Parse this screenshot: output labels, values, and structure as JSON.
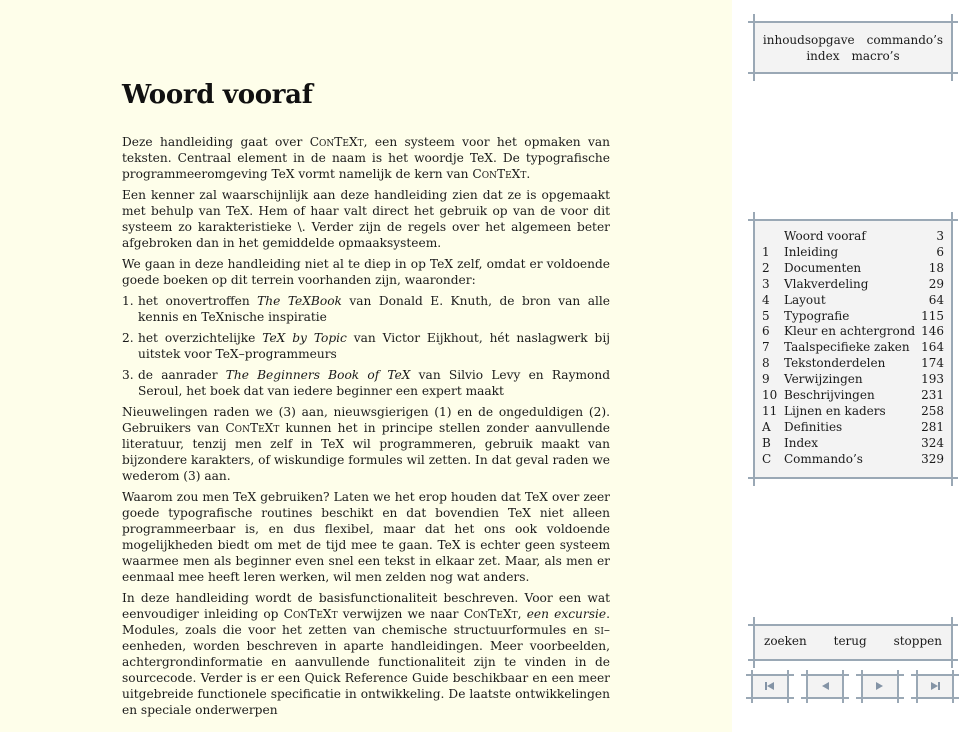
{
  "page": {
    "title": "Woord vooraf",
    "paragraphs": {
      "p1": {
        "a": "Deze handleiding gaat over ",
        "context": "ConTeXt",
        "b": ", een systeem voor het opmaken van teksten. Centraal element in de naam is het woordje TeX. De typografische programmeeromgeving TeX vormt namelijk de kern van ",
        "context2": "ConTeXt",
        "c": "."
      },
      "p2": "Een kenner zal waarschijnlijk aan deze handleiding zien dat ze is opgemaakt met behulp van TeX. Hem of haar valt direct het gebruik op van de voor dit systeem zo karakteristieke \\. Verder zijn de regels over het algemeen beter afgebroken dan in het gemiddelde opmaaksysteem.",
      "p3": "We gaan in deze handleiding niet al te diep in op TeX zelf, omdat er voldoende goede boeken op dit terrein voorhanden zijn, waaronder:",
      "list": [
        {
          "num": "1.",
          "a": "het onovertroffen ",
          "title": "The TeXBook",
          "b": " van Donald E. Knuth, de bron van alle kennis en TeXnische inspiratie"
        },
        {
          "num": "2.",
          "a": "het overzichtelijke ",
          "title": "TeX by Topic",
          "b": " van Victor Eijkhout, hét naslagwerk bij uitstek voor TeX–programmeurs"
        },
        {
          "num": "3.",
          "a": "de aanrader ",
          "title": "The Beginners Book of TeX",
          "b": " van Silvio Levy en Raymond Seroul, het boek dat van iedere beginner een expert maakt"
        }
      ],
      "p4": {
        "a": "Nieuwelingen raden we (3) aan, nieuwsgierigen (1) en de ongeduldigen (2). Gebruikers van ",
        "context": "ConTeXt",
        "b": " kunnen het in principe stellen zonder aanvullende literatuur, tenzij men zelf in TeX wil programmeren, gebruik maakt van bijzondere karakters, of wiskundige formules wil zetten. In dat geval raden we wederom (3) aan."
      },
      "p5": "Waarom zou men TeX gebruiken? Laten we het erop houden dat TeX over zeer goede typografische routines beschikt en dat bovendien TeX niet alleen programmeerbaar is, en dus flexibel, maar dat het ons ook voldoende mogelijkheden biedt om met de tijd mee te gaan. TeX is echter geen systeem waarmee men als beginner even snel een tekst in elkaar zet. Maar, als men er eenmaal mee heeft leren werken, wil men zelden nog wat anders.",
      "p6": {
        "a": "In deze handleiding wordt de basisfunctionaliteit beschreven. Voor een wat eenvoudiger inleiding op ",
        "context": "ConTeXt",
        "b": " verwijzen we naar ",
        "context2": "ConTeXt",
        "c": ", ",
        "em": "een excursie",
        "d": ". Modules, zoals die voor het zetten van chemische structuurformules en ",
        "si": "si",
        "e": "–eenheden, worden beschreven in aparte handleidingen. Meer voorbeelden, achtergrondinformatie en aanvullende functionaliteit zijn te vinden in de sourcecode. Verder is er een Quick Reference Guide beschikbaar en een meer uitgebreide functionele specificatie in ontwikkeling. De laatste ontwikkelingen en speciale onderwerpen"
      }
    }
  },
  "sidebar": {
    "top_links": [
      "inhoudsopgave",
      "commando’s",
      "index",
      "macro’s"
    ],
    "toc": [
      {
        "num": "",
        "label": "Woord vooraf",
        "page": "3"
      },
      {
        "num": "1",
        "label": "Inleiding",
        "page": "6"
      },
      {
        "num": "2",
        "label": "Documenten",
        "page": "18"
      },
      {
        "num": "3",
        "label": "Vlakverdeling",
        "page": "29"
      },
      {
        "num": "4",
        "label": "Layout",
        "page": "64"
      },
      {
        "num": "5",
        "label": "Typografie",
        "page": "115"
      },
      {
        "num": "6",
        "label": "Kleur en achtergrond",
        "page": "146"
      },
      {
        "num": "7",
        "label": "Taalspecifieke zaken",
        "page": "164"
      },
      {
        "num": "8",
        "label": "Tekstonderdelen",
        "page": "174"
      },
      {
        "num": "9",
        "label": "Verwijzingen",
        "page": "193"
      },
      {
        "num": "10",
        "label": "Beschrijvingen",
        "page": "231"
      },
      {
        "num": "11",
        "label": "Lijnen en kaders",
        "page": "258"
      },
      {
        "num": "A",
        "label": "Definities",
        "page": "281"
      },
      {
        "num": "B",
        "label": "Index",
        "page": "324"
      },
      {
        "num": "C",
        "label": "Commando’s",
        "page": "329"
      }
    ],
    "bottom_links": [
      "zoeken",
      "terug",
      "stoppen"
    ],
    "nav_icons": [
      "first-page-icon",
      "previous-page-icon",
      "next-page-icon",
      "last-page-icon"
    ],
    "colors": {
      "frame": "#9aa8b5",
      "box_bg": "#f3f3f3",
      "page_bg": "#fefeea",
      "icon": "#8494a6"
    }
  }
}
